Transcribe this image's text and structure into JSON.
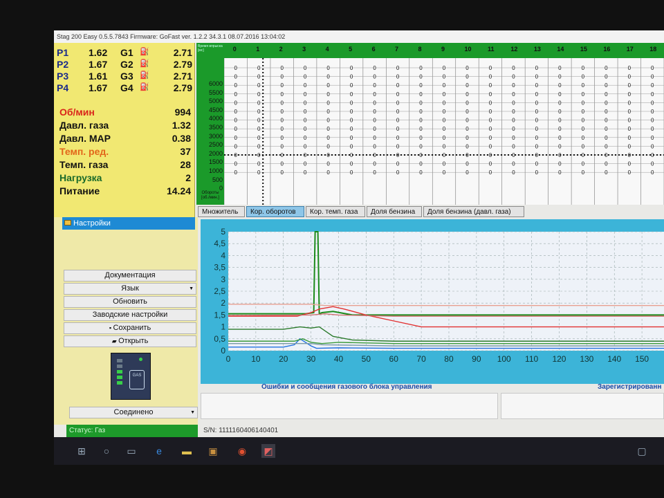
{
  "window": {
    "title": "Stag 200 Easy 0.5.5.7843 Firmware: GoFast  ver. 1.2.2  34.3.1  08.07.2016 13:04:02"
  },
  "injectors": [
    {
      "p": "P1",
      "pv": "1.62",
      "g": "G1",
      "gv": "2.71"
    },
    {
      "p": "P2",
      "pv": "1.67",
      "g": "G2",
      "gv": "2.79"
    },
    {
      "p": "P3",
      "pv": "1.61",
      "g": "G3",
      "gv": "2.71"
    },
    {
      "p": "P4",
      "pv": "1.67",
      "g": "G4",
      "gv": "2.79"
    }
  ],
  "params": [
    {
      "label": "Об/мин",
      "value": "994",
      "color": "#d9241a"
    },
    {
      "label": "Давл. газа",
      "value": "1.32",
      "color": "#111111"
    },
    {
      "label": "Давл. MAP",
      "value": "0.38",
      "color": "#111111"
    },
    {
      "label": "Темп. ред.",
      "value": "37",
      "color": "#e2661a"
    },
    {
      "label": "Темп. газа",
      "value": "28",
      "color": "#111111"
    },
    {
      "label": "Нагрузка",
      "value": "2",
      "color": "#1a6a2a"
    },
    {
      "label": "Питание",
      "value": "14.24",
      "color": "#111111"
    }
  ],
  "map": {
    "corner": "Время впрыска [мс]",
    "axis_label": "Обороты [об./мин.]",
    "columns": [
      "0",
      "1",
      "2",
      "3",
      "4",
      "5",
      "6",
      "7",
      "8",
      "9",
      "10",
      "11",
      "12",
      "13",
      "14",
      "15",
      "16",
      "17",
      "18"
    ],
    "rpm": [
      "6000",
      "5500",
      "5000",
      "4500",
      "4000",
      "3500",
      "3000",
      "2500",
      "2000",
      "1500",
      "1000",
      "500",
      "0"
    ],
    "cell_value": "0"
  },
  "tabs": [
    {
      "label": "Множитель",
      "active": false
    },
    {
      "label": "Кор. оборотов",
      "active": true
    },
    {
      "label": "Кор. темп. газа",
      "active": false
    },
    {
      "label": "Доля бензина",
      "active": false
    },
    {
      "label": "Доля бензина (давл. газа)",
      "active": false
    }
  ],
  "settings": {
    "header": "Настройки",
    "buttons": [
      "Документация",
      "Язык",
      "Обновить",
      "Заводские настройки",
      "Сохранить",
      "Открыть"
    ],
    "connection": "Соединено"
  },
  "status": {
    "left": "Статус: Газ",
    "right": "S/N: 1111160406140401"
  },
  "messages": {
    "label": "Ошибки и сообщения газового блока управления",
    "registered": "Зарегистрированн"
  },
  "chart_data": {
    "type": "line",
    "x_ticks": [
      0,
      10,
      20,
      30,
      40,
      50,
      60,
      70,
      80,
      90,
      100,
      110,
      120,
      130,
      140,
      150
    ],
    "y_ticks": [
      "0",
      "0,5",
      "1",
      "1,5",
      "2",
      "2,5",
      "3",
      "3,5",
      "4",
      "4,5",
      "5"
    ],
    "xlim": [
      0,
      158
    ],
    "ylim": [
      0,
      5
    ],
    "series": [
      {
        "color": "#1a8a1a",
        "x": [
          0,
          28,
          31,
          31.5,
          32.5,
          33,
          34,
          38,
          45,
          60,
          158
        ],
        "y": [
          1.55,
          1.55,
          1.6,
          5,
          5,
          1.55,
          1.6,
          1.65,
          1.5,
          1.5,
          1.5
        ]
      },
      {
        "color": "#e23030",
        "x": [
          0,
          25,
          30,
          33,
          38,
          42,
          50,
          60,
          70,
          100,
          158
        ],
        "y": [
          1.45,
          1.45,
          1.6,
          1.75,
          1.85,
          1.75,
          1.5,
          1.25,
          1.0,
          1.0,
          1.0
        ]
      },
      {
        "color": "#d07070",
        "x": [
          0,
          30,
          35,
          40,
          60,
          100,
          158
        ],
        "y": [
          1.48,
          1.5,
          1.55,
          1.5,
          1.45,
          1.45,
          1.45
        ]
      },
      {
        "color": "#e8a090",
        "x": [
          0,
          30,
          35,
          158
        ],
        "y": [
          1.95,
          1.95,
          1.9,
          1.9
        ]
      },
      {
        "color": "#2a7a2a",
        "x": [
          0,
          20,
          26,
          30,
          33,
          38,
          45,
          60,
          158
        ],
        "y": [
          0.9,
          0.9,
          1.0,
          0.95,
          1.0,
          0.6,
          0.45,
          0.4,
          0.4
        ]
      },
      {
        "color": "#2070e0",
        "x": [
          0,
          20,
          24,
          26,
          28,
          30,
          32,
          40,
          60,
          158
        ],
        "y": [
          0.15,
          0.15,
          0.25,
          0.5,
          0.35,
          0.2,
          0.1,
          0.12,
          0.1,
          0.1
        ]
      },
      {
        "color": "#3a9a3a",
        "x": [
          0,
          24,
          27,
          30,
          34,
          40,
          60,
          158
        ],
        "y": [
          0.4,
          0.4,
          0.5,
          0.35,
          0.3,
          0.35,
          0.3,
          0.3
        ]
      },
      {
        "color": "#7a9aa8",
        "x": [
          0,
          30,
          34,
          60,
          158
        ],
        "y": [
          0.3,
          0.3,
          0.25,
          0.2,
          0.2
        ]
      }
    ]
  }
}
